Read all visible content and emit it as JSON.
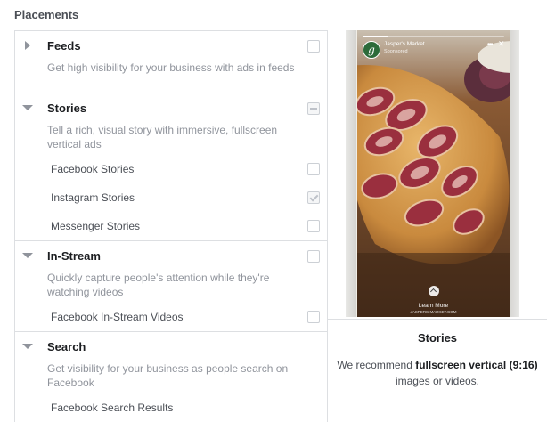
{
  "heading": "Placements",
  "sections": {
    "feeds": {
      "title": "Feeds",
      "description": "Get high visibility for your business with ads in feeds",
      "expanded": false,
      "checkbox": "unchecked"
    },
    "stories": {
      "title": "Stories",
      "description": "Tell a rich, visual story with immersive, fullscreen vertical ads",
      "expanded": true,
      "checkbox": "mixed",
      "items": [
        {
          "label": "Facebook Stories",
          "checkbox": "unchecked"
        },
        {
          "label": "Instagram Stories",
          "checkbox": "checked-disabled"
        },
        {
          "label": "Messenger Stories",
          "checkbox": "unchecked"
        }
      ]
    },
    "instream": {
      "title": "In-Stream",
      "description": "Quickly capture people's attention while they're watching videos",
      "expanded": true,
      "checkbox": "unchecked",
      "items": [
        {
          "label": "Facebook In-Stream Videos",
          "checkbox": "unchecked"
        }
      ]
    },
    "search": {
      "title": "Search",
      "description": "Get visibility for your business as people search on Facebook",
      "expanded": true,
      "items": [
        {
          "label": "Facebook Search Results"
        }
      ]
    }
  },
  "preview": {
    "story": {
      "brand_initial": "g",
      "brand_name": "Jasper's Market",
      "sponsored": "Sponsored",
      "cta_label": "Learn More",
      "cta_url": "JASPERS-MARKET.COM",
      "progress": 0.18
    },
    "title": "Stories",
    "text_pre": "We recommend ",
    "text_bold": "fullscreen vertical (9:16)",
    "text_post": " images or videos."
  },
  "colors": {
    "border": "#dddfe2",
    "muted_text": "#90949c",
    "label_text": "#4b4f56"
  }
}
